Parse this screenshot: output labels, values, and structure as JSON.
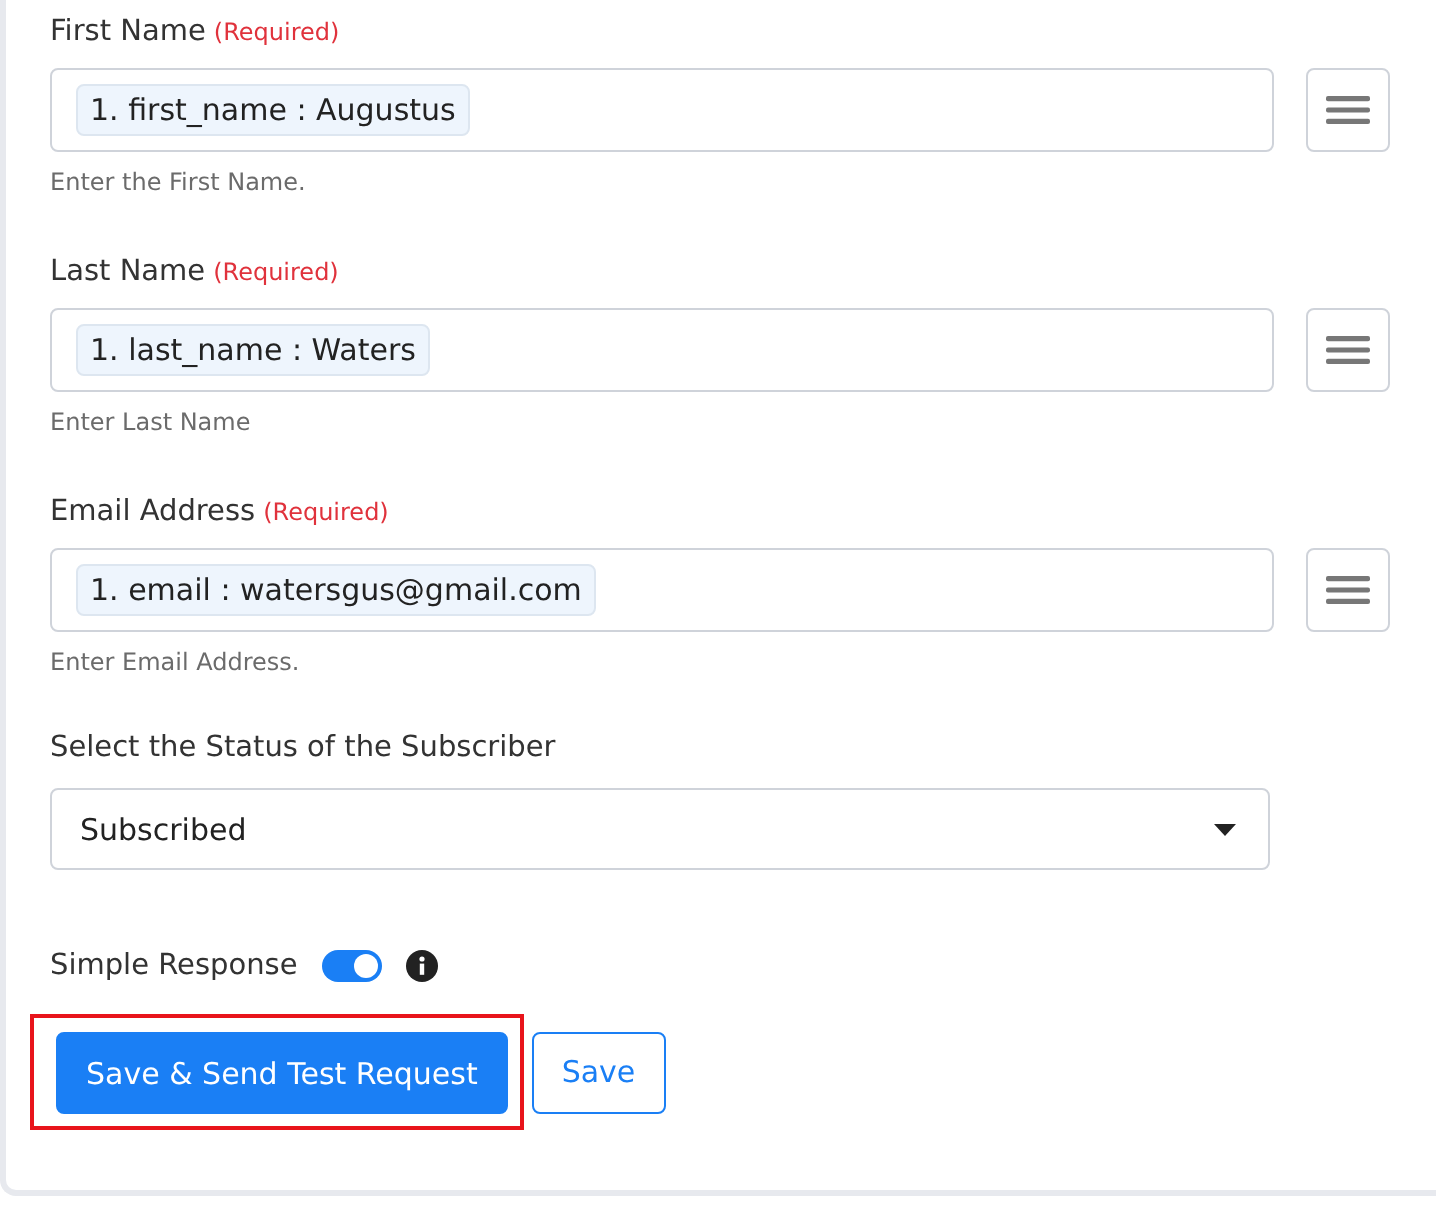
{
  "fields": [
    {
      "label": "First Name",
      "required_note": "(Required)",
      "token": "1. first_name : Augustus",
      "hint": "Enter the First Name."
    },
    {
      "label": "Last Name",
      "required_note": "(Required)",
      "token": "1. last_name : Waters",
      "hint": "Enter Last Name"
    },
    {
      "label": "Email Address",
      "required_note": "(Required)",
      "token": "1. email : watersgus@gmail.com",
      "hint": "Enter Email Address."
    }
  ],
  "status_select": {
    "label": "Select the Status of the Subscriber",
    "value": "Subscribed"
  },
  "simple_response": {
    "label": "Simple Response",
    "on": true
  },
  "buttons": [
    {
      "label": "Save & Send Test Request",
      "kind": "primary",
      "highlighted": true
    },
    {
      "label": "Save",
      "kind": "outline",
      "highlighted": false
    }
  ]
}
